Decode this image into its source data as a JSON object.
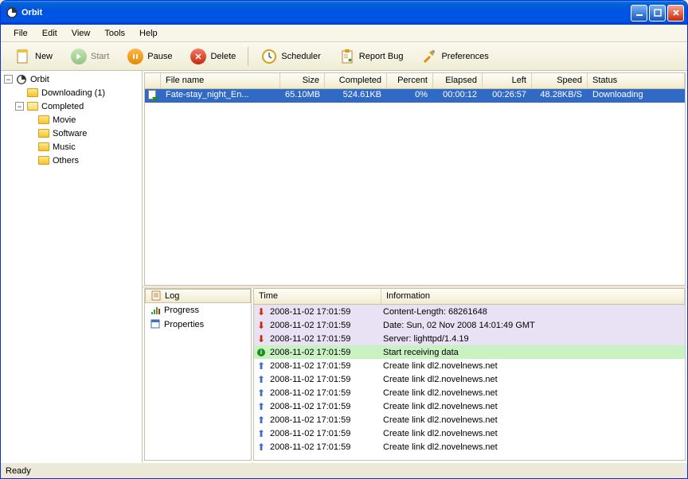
{
  "window": {
    "title": "Orbit"
  },
  "menu": {
    "file": "File",
    "edit": "Edit",
    "view": "View",
    "tools": "Tools",
    "help": "Help"
  },
  "toolbar": {
    "new": "New",
    "start": "Start",
    "pause": "Pause",
    "delete": "Delete",
    "scheduler": "Scheduler",
    "reportbug": "Report Bug",
    "preferences": "Preferences"
  },
  "tree": {
    "root": "Orbit",
    "downloading": "Downloading  (1)",
    "completed": "Completed",
    "movie": "Movie",
    "software": "Software",
    "music": "Music",
    "others": "Others"
  },
  "grid": {
    "cols": {
      "filename": "File name",
      "size": "Size",
      "completed": "Completed",
      "percent": "Percent",
      "elapsed": "Elapsed",
      "left": "Left",
      "speed": "Speed",
      "status": "Status"
    },
    "row": {
      "filename": "Fate-stay_night_En...",
      "size": "65.10MB",
      "completed": "524.61KB",
      "percent": "0%",
      "elapsed": "00:00:12",
      "left": "00:26:57",
      "speed": "48.28KB/S",
      "status": "Downloading"
    }
  },
  "tabs": {
    "log": "Log",
    "progress": "Progress",
    "properties": "Properties"
  },
  "log": {
    "cols": {
      "time": "Time",
      "info": "Information"
    },
    "rows": [
      {
        "icon": "down",
        "bg": "purple",
        "time": "2008-11-02 17:01:59",
        "info": "Content-Length: 68261648"
      },
      {
        "icon": "down",
        "bg": "purple",
        "time": "2008-11-02 17:01:59",
        "info": "Date: Sun, 02 Nov 2008 14:01:49 GMT"
      },
      {
        "icon": "down",
        "bg": "purple",
        "time": "2008-11-02 17:01:59",
        "info": "Server: lighttpd/1.4.19"
      },
      {
        "icon": "info",
        "bg": "green",
        "time": "2008-11-02 17:01:59",
        "info": "Start receiving data"
      },
      {
        "icon": "up",
        "bg": "",
        "time": "2008-11-02 17:01:59",
        "info": "Create link dl2.novelnews.net"
      },
      {
        "icon": "up",
        "bg": "",
        "time": "2008-11-02 17:01:59",
        "info": "Create link dl2.novelnews.net"
      },
      {
        "icon": "up",
        "bg": "",
        "time": "2008-11-02 17:01:59",
        "info": "Create link dl2.novelnews.net"
      },
      {
        "icon": "up",
        "bg": "",
        "time": "2008-11-02 17:01:59",
        "info": "Create link dl2.novelnews.net"
      },
      {
        "icon": "up",
        "bg": "",
        "time": "2008-11-02 17:01:59",
        "info": "Create link dl2.novelnews.net"
      },
      {
        "icon": "up",
        "bg": "",
        "time": "2008-11-02 17:01:59",
        "info": "Create link dl2.novelnews.net"
      },
      {
        "icon": "up",
        "bg": "",
        "time": "2008-11-02 17:01:59",
        "info": "Create link dl2.novelnews.net"
      }
    ]
  },
  "status": "Ready"
}
